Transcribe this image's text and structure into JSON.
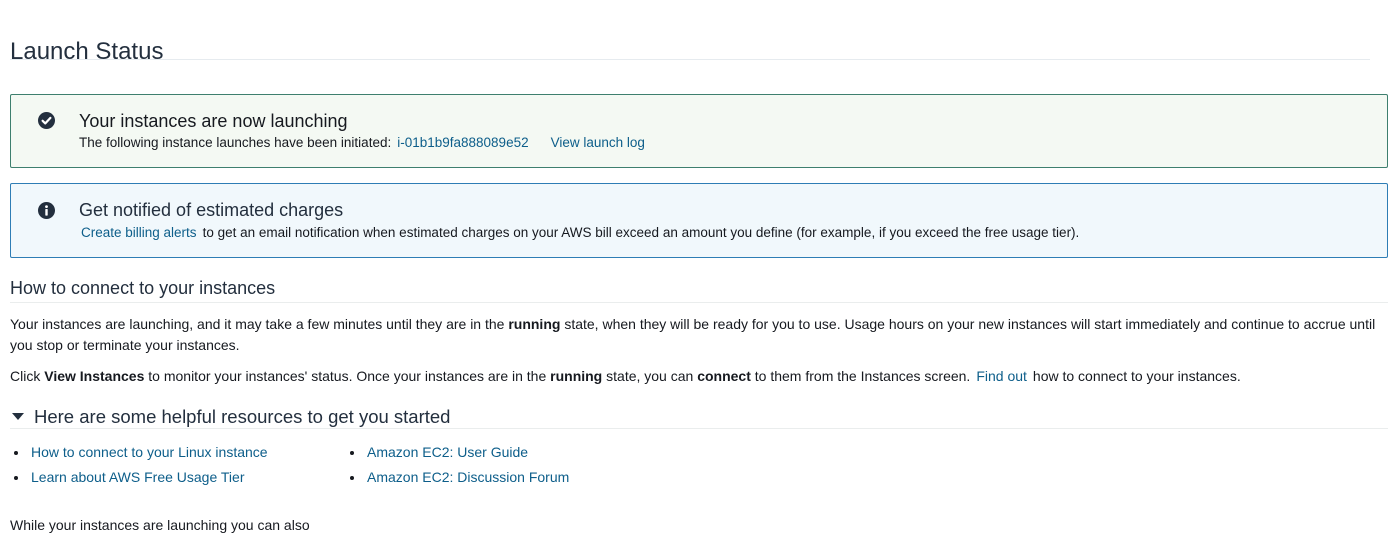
{
  "page": {
    "title": "Launch Status"
  },
  "success_alert": {
    "icon": "check-circle-icon",
    "heading": "Your instances are now launching",
    "text": "The following instance launches have been initiated:",
    "instance_id": "i-01b1b9fa888089e52",
    "log_link": "View launch log"
  },
  "info_alert": {
    "icon": "info-circle-icon",
    "heading": "Get notified of estimated charges",
    "link": "Create billing alerts",
    "text": "to get an email notification when estimated charges on your AWS bill exceed an amount you define (for example, if you exceed the free usage tier)."
  },
  "connect_section": {
    "title": "How to connect to your instances",
    "para1": {
      "a": "Your instances are launching, and it may take a few minutes until they are in the",
      "b1": "running",
      "c": "state, when they will be ready for you to use. Usage hours on your new instances will start immediately and continue to accrue until you stop or terminate your instances."
    },
    "para2": {
      "a": "Click",
      "b1": "View Instances",
      "c": "to monitor your instances' status. Once your instances are in the",
      "b2": "running",
      "d": "state, you can",
      "b3": "connect",
      "e": "to them from the Instances screen.",
      "link": "Find out",
      "f": "how to connect to your instances."
    }
  },
  "resources": {
    "title": "Here are some helpful resources to get you started",
    "left": [
      {
        "label": "How to connect to your Linux instance"
      },
      {
        "label": "Learn about AWS Free Usage Tier"
      }
    ],
    "right": [
      {
        "label": "Amazon EC2: User Guide"
      },
      {
        "label": "Amazon EC2: Discussion Forum"
      }
    ]
  },
  "footer": {
    "text": "While your instances are launching you can also"
  },
  "colors": {
    "link": "#0d5e8a",
    "success_border": "#3d7f6e",
    "success_bg": "#f4f9f3",
    "info_border": "#2e7db5",
    "info_bg": "#f1f8fc"
  }
}
